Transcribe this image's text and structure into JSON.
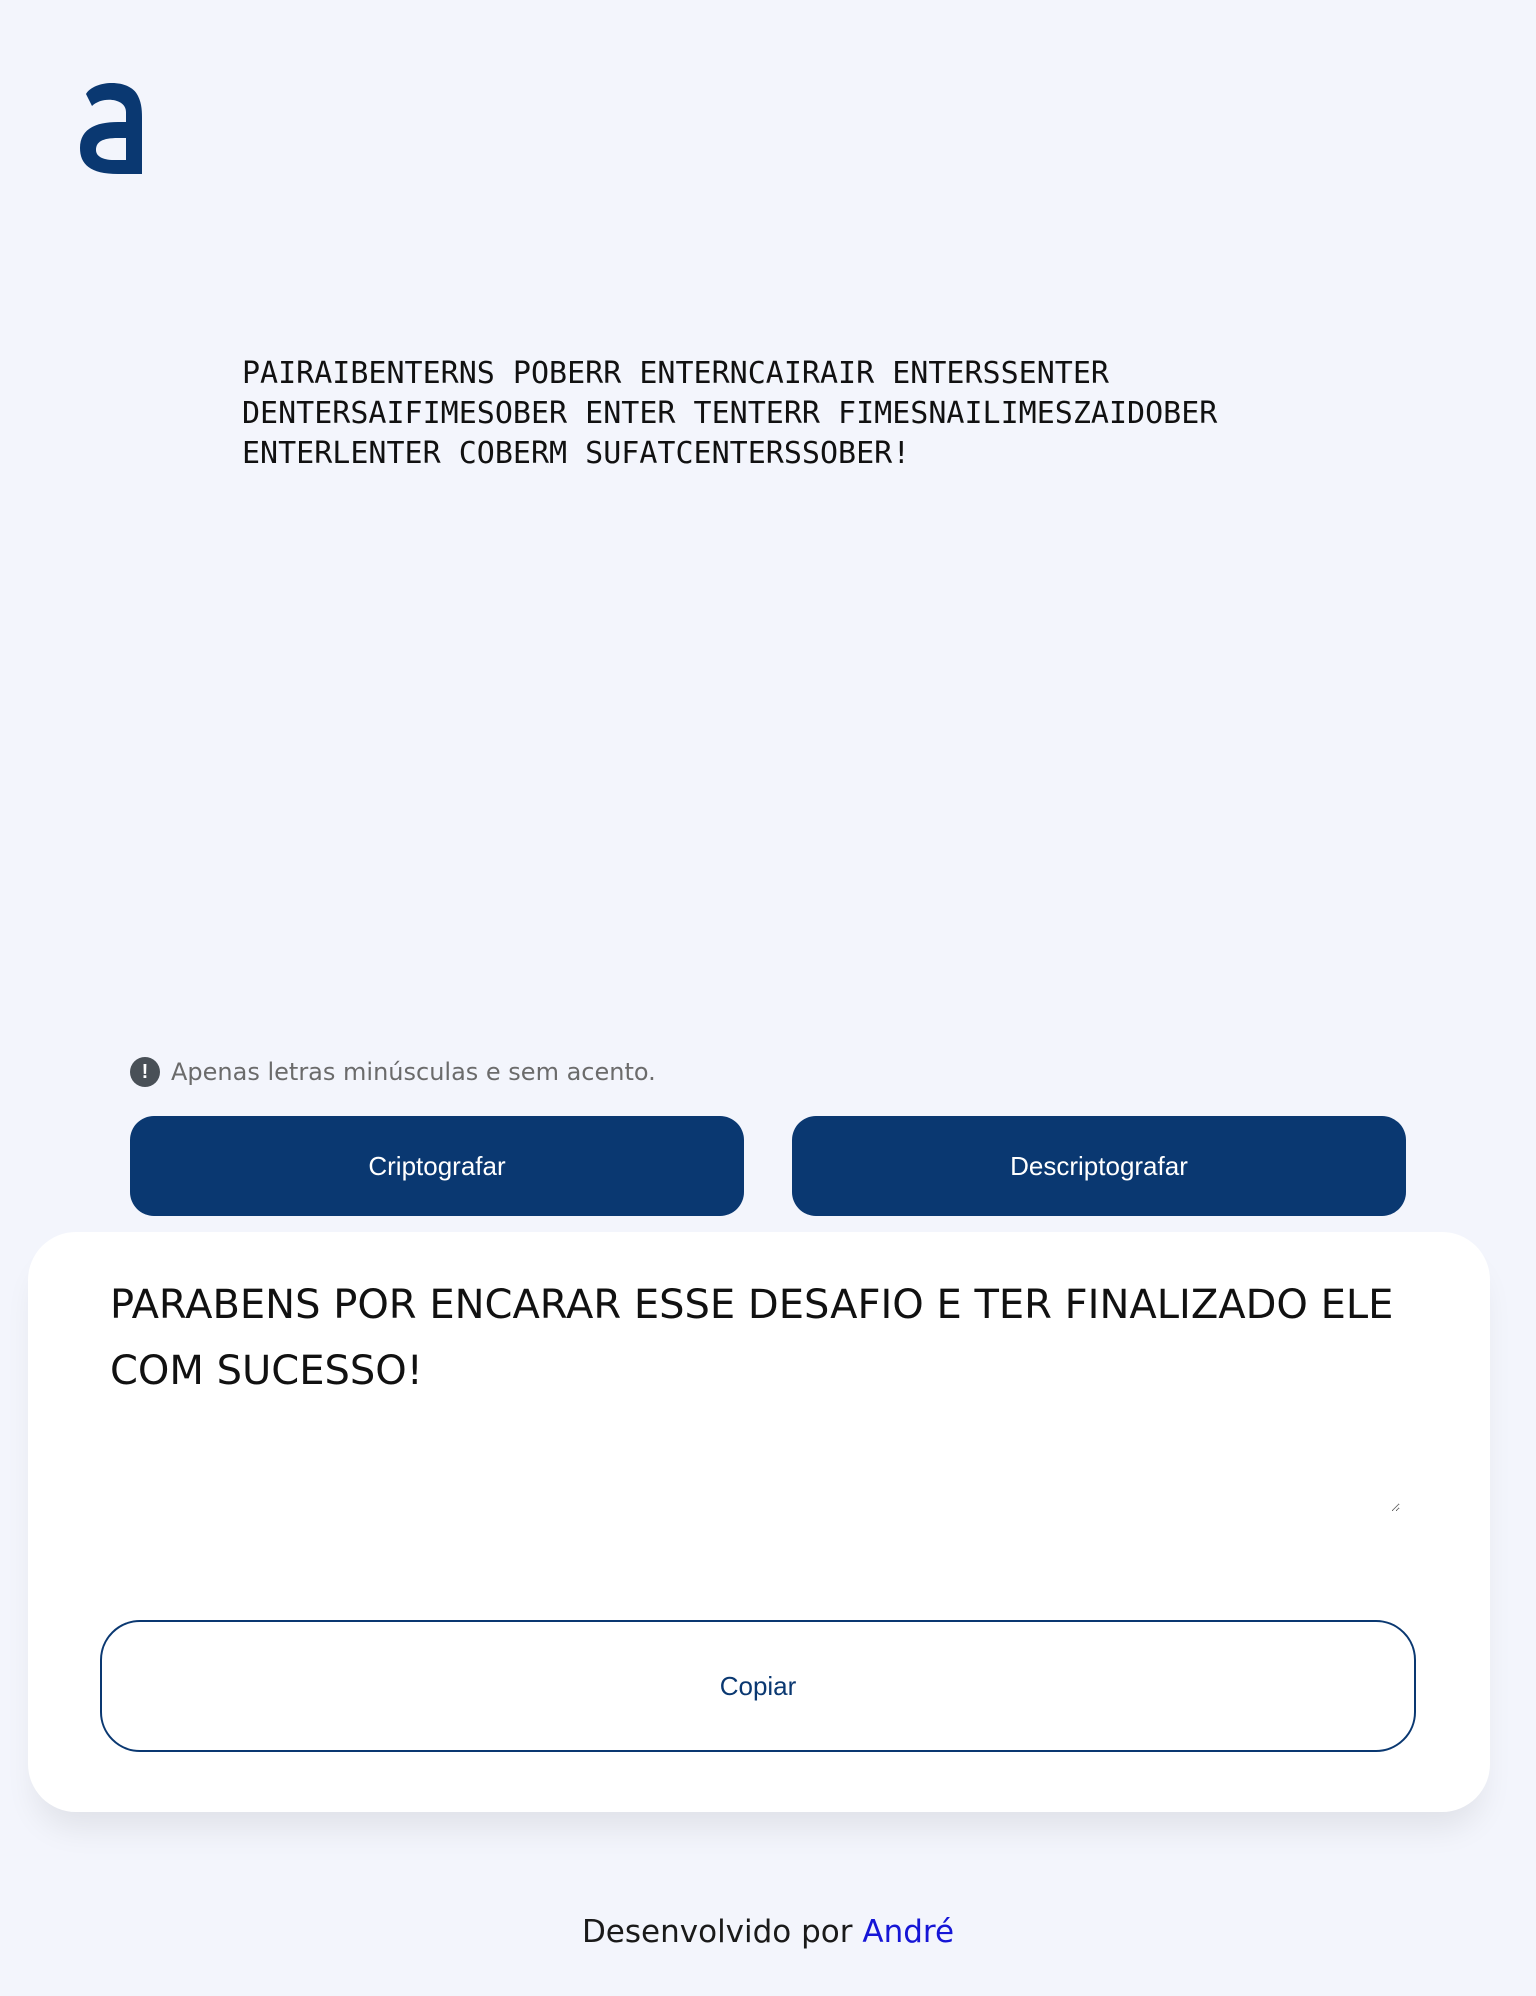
{
  "logo": {
    "icon": "letter-a-logo",
    "color": "#0A3871"
  },
  "input": {
    "value": "PAIRAIBENTERNS POBERR ENTERNCAIRAIR ENTERSSENTER DENTERSAIFIMESOBER ENTER TENTERR FIMESNAILIMESZAIDOBER ENTERLENTER COBERM SUFATCENTERSSOBER!"
  },
  "hint": {
    "icon": "exclamation-circle-icon",
    "text": "Apenas letras minúsculas e sem acento."
  },
  "buttons": {
    "encrypt_label": "Criptografar",
    "decrypt_label": "Descriptografar",
    "copy_label": "Copiar"
  },
  "output": {
    "value": "PARABENS POR ENCARAR ESSE DESAFIO E TER FINALIZADO ELE COM SUCESSO!"
  },
  "footer": {
    "prefix": "Desenvolvido por ",
    "author": "André"
  },
  "colors": {
    "background": "#F3F5FC",
    "primary": "#0A3871",
    "link": "#1515D6"
  }
}
